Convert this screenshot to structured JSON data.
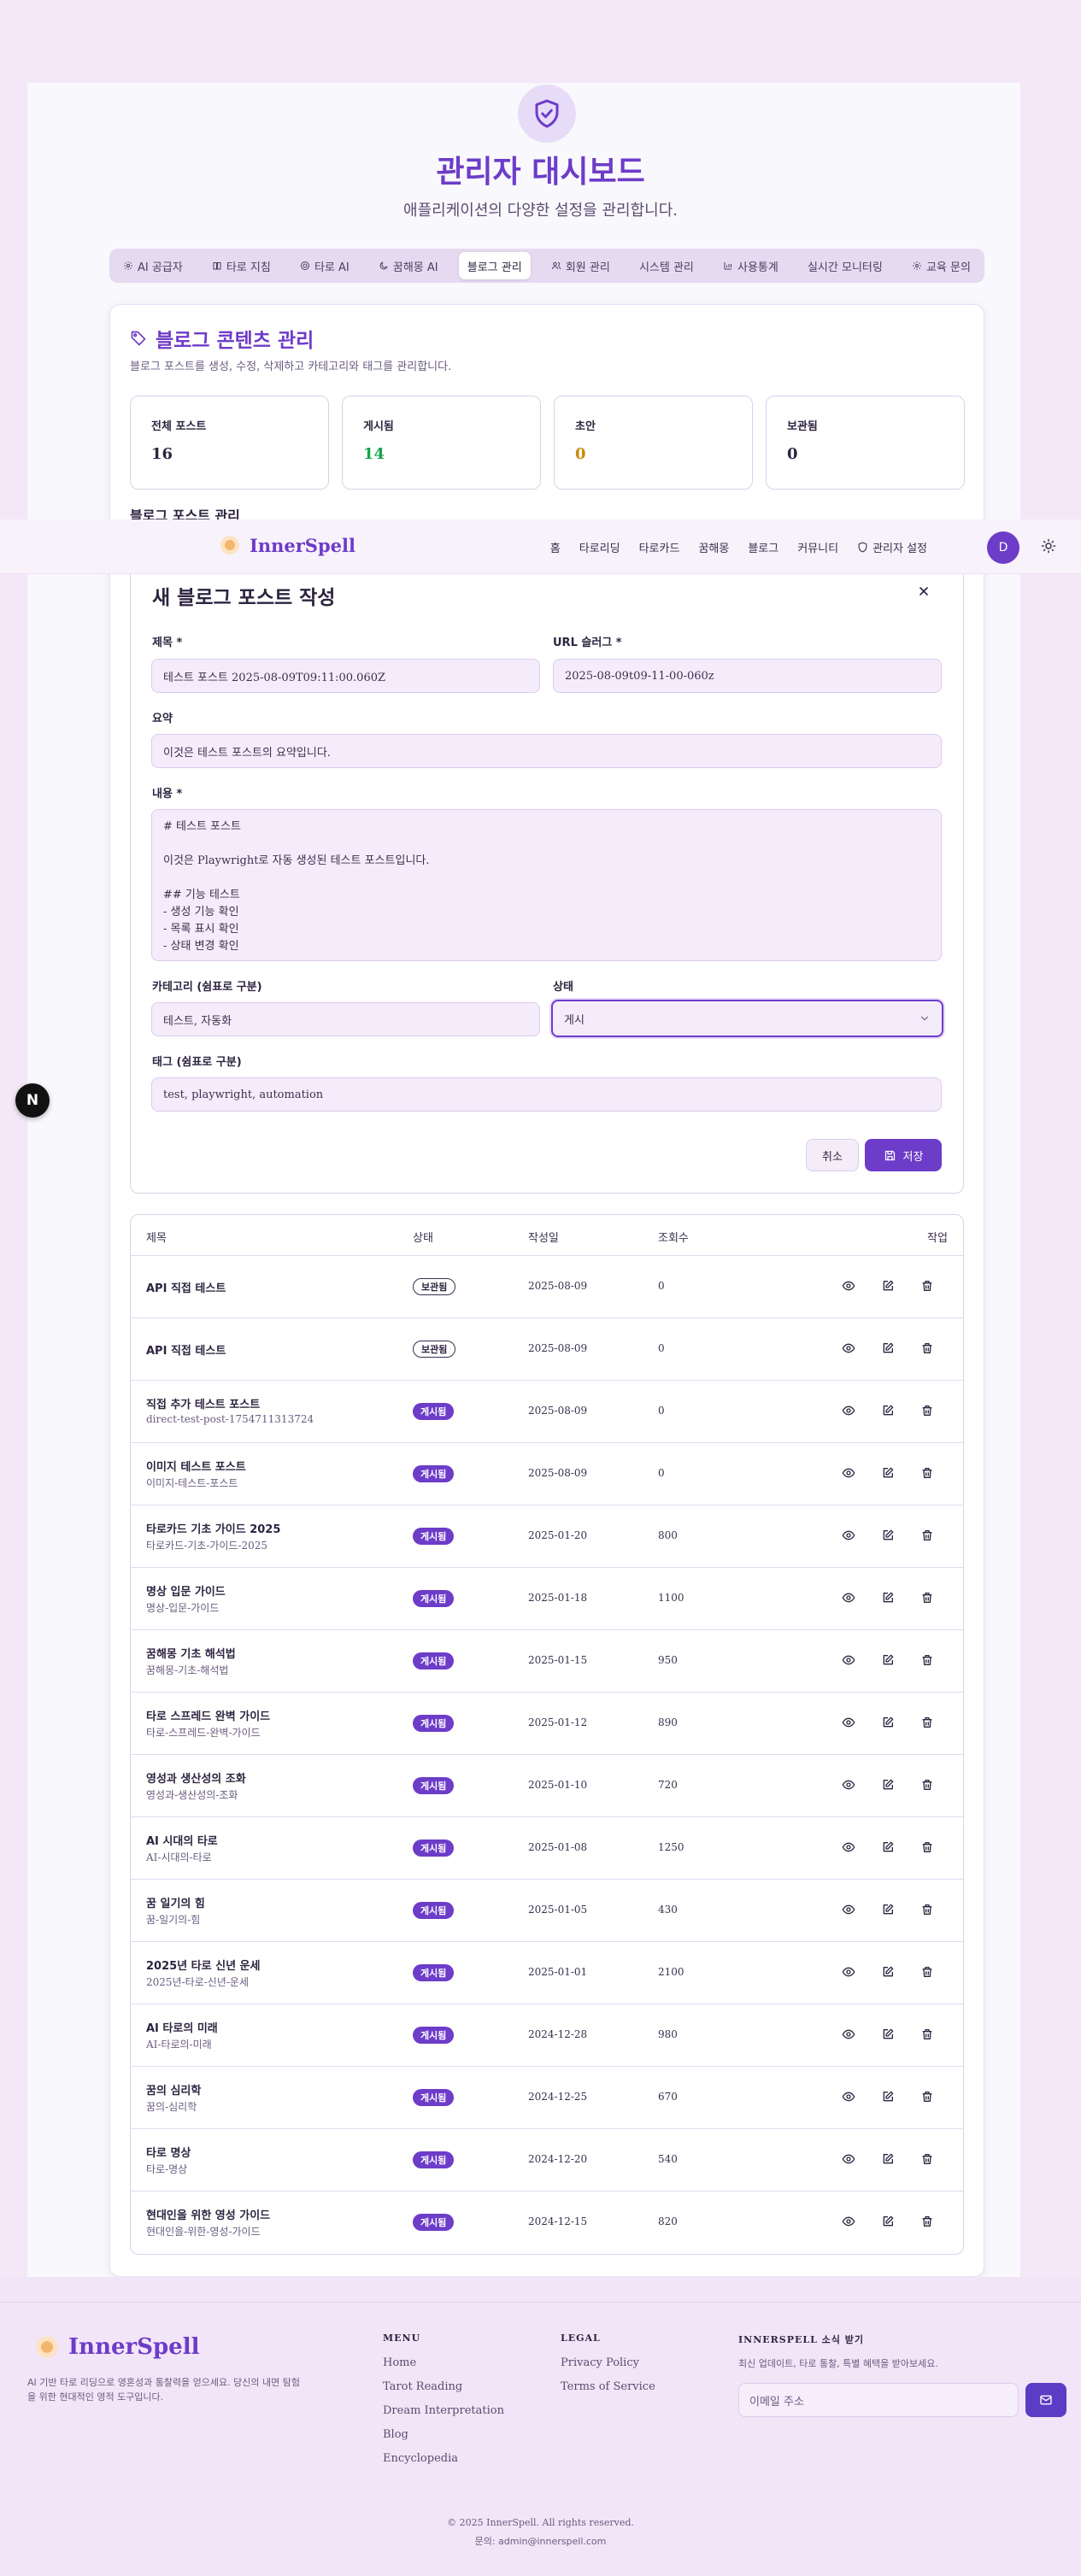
{
  "page": {
    "title": "관리자 대시보드",
    "subtitle": "애플리케이션의 다양한 설정을 관리합니다."
  },
  "tabs": [
    {
      "label": "AI 공급자",
      "icon": "gear-icon"
    },
    {
      "label": "타로 지침",
      "icon": "book-icon"
    },
    {
      "label": "타로 AI",
      "icon": "target-icon"
    },
    {
      "label": "꿈해몽 AI",
      "icon": "moon-icon"
    },
    {
      "label": "블로그 관리",
      "icon": "",
      "active": true
    },
    {
      "label": "회원 관리",
      "icon": "users-icon"
    },
    {
      "label": "시스템 관리",
      "icon": ""
    },
    {
      "label": "사용통계",
      "icon": "bar-chart-icon"
    },
    {
      "label": "실시간 모니터링",
      "icon": ""
    },
    {
      "label": "교육 문의",
      "icon": "gear-icon"
    }
  ],
  "blog": {
    "title": "블로그 콘텐츠 관리",
    "description": "블로그 포스트를 생성, 수정, 삭제하고 카테고리와 태그를 관리합니다.",
    "stats": [
      {
        "label": "전체 포스트",
        "value": "16",
        "color": "#2d2440"
      },
      {
        "label": "게시됨",
        "value": "14",
        "color": "#16a34a"
      },
      {
        "label": "초안",
        "value": "0",
        "color": "#ca8a04"
      },
      {
        "label": "보관됨",
        "value": "0",
        "color": "#2d2440"
      }
    ],
    "overlap_label": "블로그 포스트 관리"
  },
  "navbar": {
    "brand": "InnerSpell",
    "links": [
      "홈",
      "타로리딩",
      "타로카드",
      "꿈해몽",
      "블로그",
      "커뮤니티",
      "관리자 설정"
    ],
    "avatar": "D"
  },
  "form": {
    "heading": "새 블로그 포스트 작성",
    "title_label": "제목 *",
    "title_value": "테스트 포스트 2025-08-09T09:11:00.060Z",
    "slug_label": "URL 슬러그 *",
    "slug_value": "2025-08-09t09-11-00-060z",
    "summary_label": "요약",
    "summary_value": "이것은 테스트 포스트의 요약입니다.",
    "content_label": "내용 *",
    "content_value": "# 테스트 포스트\n\n이것은 Playwright로 자동 생성된 테스트 포스트입니다.\n\n## 기능 테스트\n- 생성 기능 확인\n- 목록 표시 확인\n- 상태 변경 확인",
    "category_label": "카테고리 (쉼표로 구분)",
    "category_value": "테스트, 자동화",
    "status_label": "상태",
    "status_value": "게시",
    "tags_label": "태그 (쉼표로 구분)",
    "tags_value": "test, playwright, automation",
    "cancel": "취소",
    "save": "저장"
  },
  "table": {
    "headers": {
      "title": "제목",
      "status": "상태",
      "date": "작성일",
      "views": "조회수",
      "actions": "작업"
    },
    "rows": [
      {
        "title": "API 직접 테스트",
        "slug": "",
        "status": "보관됨",
        "date": "2025-08-09",
        "views": "0"
      },
      {
        "title": "API 직접 테스트",
        "slug": "",
        "status": "보관됨",
        "date": "2025-08-09",
        "views": "0"
      },
      {
        "title": "직접 추가 테스트 포스트",
        "slug": "direct-test-post-1754711313724",
        "status": "게시됨",
        "date": "2025-08-09",
        "views": "0"
      },
      {
        "title": "이미지 테스트 포스트",
        "slug": "이미지-테스트-포스트",
        "status": "게시됨",
        "date": "2025-08-09",
        "views": "0"
      },
      {
        "title": "타로카드 기초 가이드 2025",
        "slug": "타로카드-기초-가이드-2025",
        "status": "게시됨",
        "date": "2025-01-20",
        "views": "800"
      },
      {
        "title": "명상 입문 가이드",
        "slug": "명상-입문-가이드",
        "status": "게시됨",
        "date": "2025-01-18",
        "views": "1100"
      },
      {
        "title": "꿈해몽 기초 해석법",
        "slug": "꿈해몽-기초-해석법",
        "status": "게시됨",
        "date": "2025-01-15",
        "views": "950"
      },
      {
        "title": "타로 스프레드 완벽 가이드",
        "slug": "타로-스프레드-완벽-가이드",
        "status": "게시됨",
        "date": "2025-01-12",
        "views": "890"
      },
      {
        "title": "영성과 생산성의 조화",
        "slug": "영성과-생산성의-조화",
        "status": "게시됨",
        "date": "2025-01-10",
        "views": "720"
      },
      {
        "title": "AI 시대의 타로",
        "slug": "AI-시대의-타로",
        "status": "게시됨",
        "date": "2025-01-08",
        "views": "1250"
      },
      {
        "title": "꿈 일기의 힘",
        "slug": "꿈-일기의-힘",
        "status": "게시됨",
        "date": "2025-01-05",
        "views": "430"
      },
      {
        "title": "2025년 타로 신년 운세",
        "slug": "2025년-타로-신년-운세",
        "status": "게시됨",
        "date": "2025-01-01",
        "views": "2100"
      },
      {
        "title": "AI 타로의 미래",
        "slug": "AI-타로의-미래",
        "status": "게시됨",
        "date": "2024-12-28",
        "views": "980"
      },
      {
        "title": "꿈의 심리학",
        "slug": "꿈의-심리학",
        "status": "게시됨",
        "date": "2024-12-25",
        "views": "670"
      },
      {
        "title": "타로 명상",
        "slug": "타로-명상",
        "status": "게시됨",
        "date": "2024-12-20",
        "views": "540"
      },
      {
        "title": "현대인을 위한 영성 가이드",
        "slug": "현대인을-위한-영성-가이드",
        "status": "게시됨",
        "date": "2024-12-15",
        "views": "820"
      }
    ]
  },
  "footer": {
    "brand": "InnerSpell",
    "description": "AI 기반 타로 리딩으로 영혼성과 통찰력을 얻으세요. 당신의 내면 탐험을 위한 현대적인 영적 도구입니다.",
    "menu_heading": "MENU",
    "menu_links": [
      "Home",
      "Tarot Reading",
      "Dream Interpretation",
      "Blog",
      "Encyclopedia"
    ],
    "legal_heading": "LEGAL",
    "legal_links": [
      "Privacy Policy",
      "Terms of Service"
    ],
    "news_heading": "INNERSPELL 소식 받기",
    "news_desc": "최신 업데이트, 타로 통찰, 특별 혜택을 받아보세요.",
    "email_placeholder": "이메일 주소",
    "copyright": "© 2025 InnerSpell. All rights reserved.",
    "contact": "문의: admin@innerspell.com"
  },
  "next_badge": "N",
  "colors": {
    "primary": "#6d3cc8",
    "background": "#f4e8f8",
    "published": "#6d3cc8"
  }
}
